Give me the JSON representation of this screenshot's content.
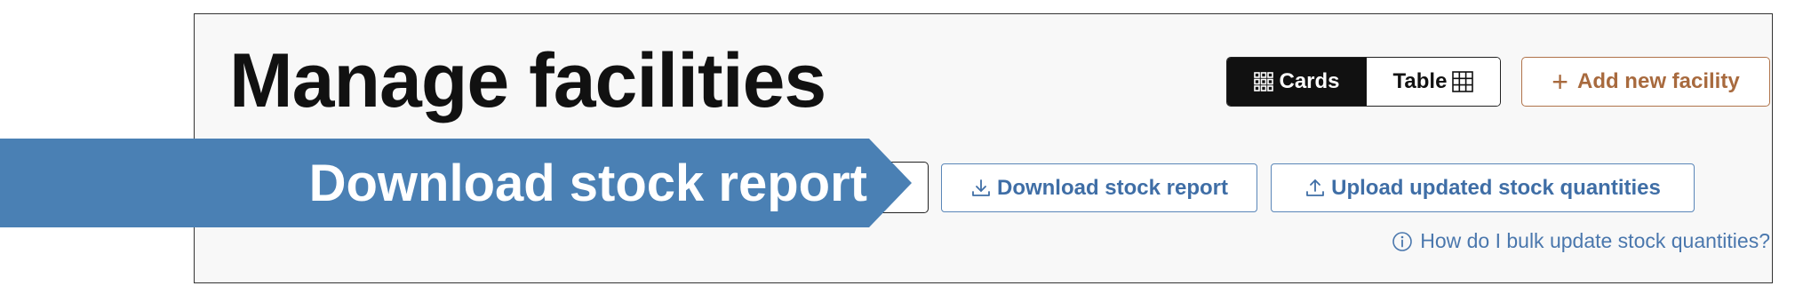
{
  "header": {
    "title": "Manage facilities"
  },
  "view_toggle": {
    "cards_label": "Cards",
    "table_label": "Table",
    "selected": "Cards"
  },
  "toolbar": {
    "add_label": "Add new facility",
    "download_label": "Download stock report",
    "upload_label": "Upload updated stock quantities"
  },
  "help": {
    "label": "How do I bulk update stock quantities?"
  },
  "callout": {
    "label": "Download stock report",
    "color": "#4a80b4"
  },
  "colors": {
    "accent_brown": "#a86a3e",
    "link_blue": "#3f6ea6",
    "toggle_active": "#111111"
  },
  "icons": {
    "cards": "grid-dots-icon",
    "table": "table-grid-icon",
    "add": "plus-icon",
    "download": "download-icon",
    "upload": "upload-icon",
    "help": "info-icon"
  }
}
